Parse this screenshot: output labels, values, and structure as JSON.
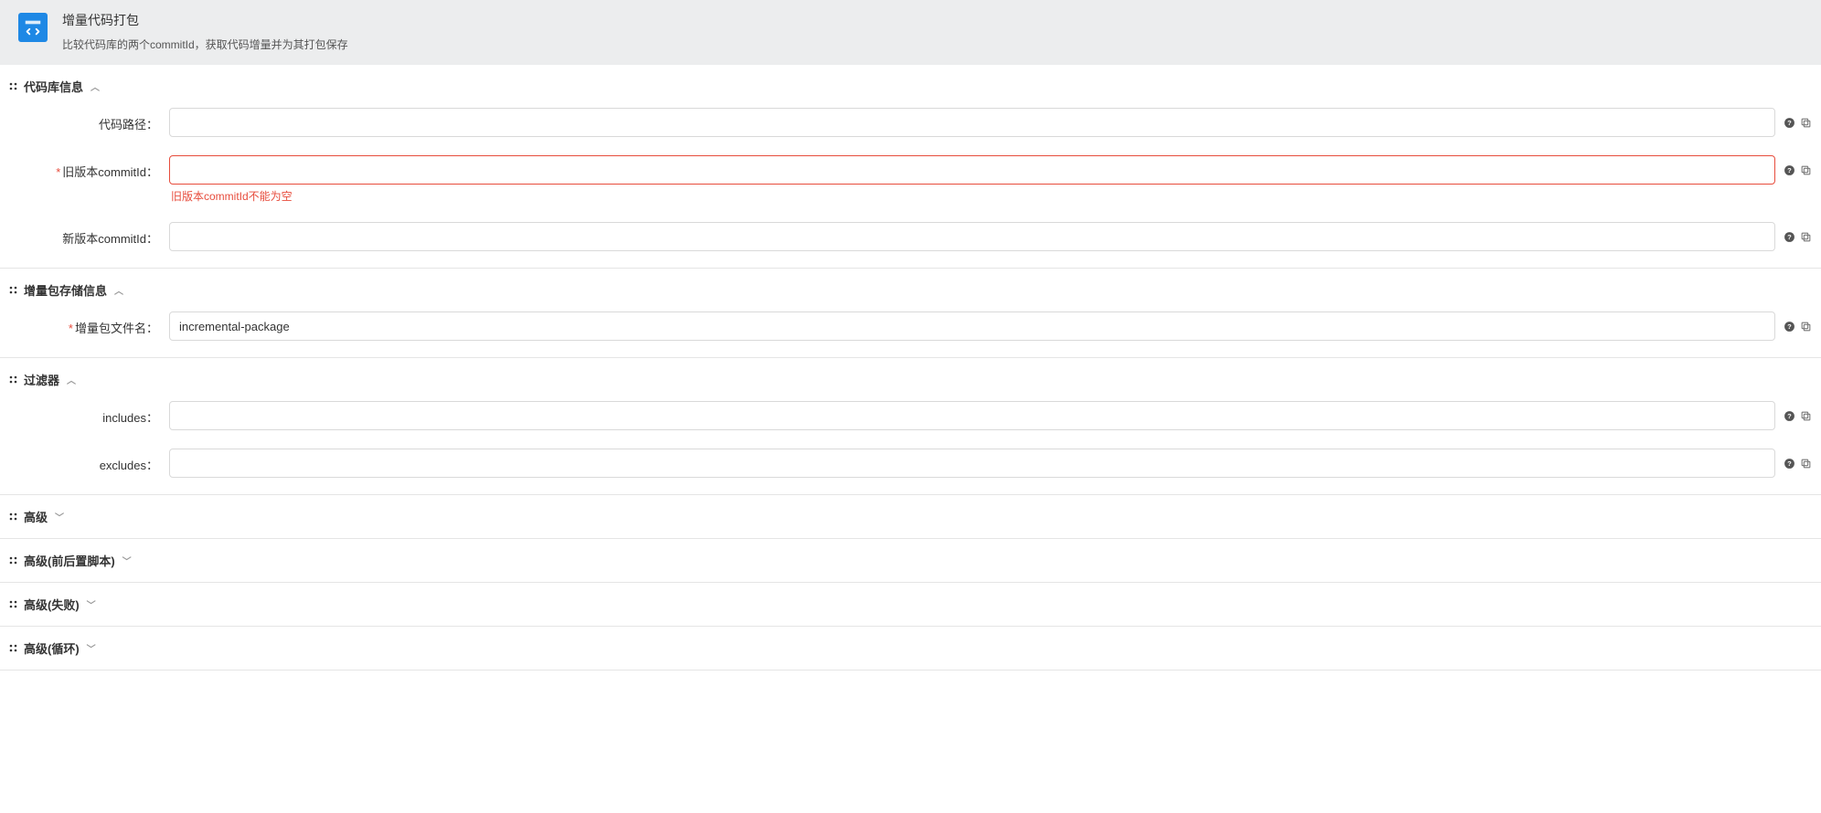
{
  "header": {
    "title": "增量代码打包",
    "description": "比较代码库的两个commitId，获取代码增量并为其打包保存"
  },
  "sections": {
    "repo": {
      "title": "代码库信息",
      "expanded": true,
      "fields": {
        "codePath": {
          "label": "代码路径：",
          "value": "",
          "required": false
        },
        "oldCommit": {
          "label": "旧版本commitId：",
          "value": "",
          "required": true,
          "error": "旧版本commitId不能为空"
        },
        "newCommit": {
          "label": "新版本commitId：",
          "value": "",
          "required": false
        }
      }
    },
    "storage": {
      "title": "增量包存储信息",
      "expanded": true,
      "fields": {
        "packageName": {
          "label": "增量包文件名：",
          "value": "incremental-package",
          "required": true
        }
      }
    },
    "filter": {
      "title": "过滤器",
      "expanded": true,
      "fields": {
        "includes": {
          "label": "includes：",
          "value": "",
          "required": false
        },
        "excludes": {
          "label": "excludes：",
          "value": "",
          "required": false
        }
      }
    },
    "advanced": {
      "title": "高级",
      "expanded": false
    },
    "advancedScripts": {
      "title": "高级(前后置脚本)",
      "expanded": false
    },
    "advancedFail": {
      "title": "高级(失败)",
      "expanded": false
    },
    "advancedLoop": {
      "title": "高级(循环)",
      "expanded": false
    }
  }
}
